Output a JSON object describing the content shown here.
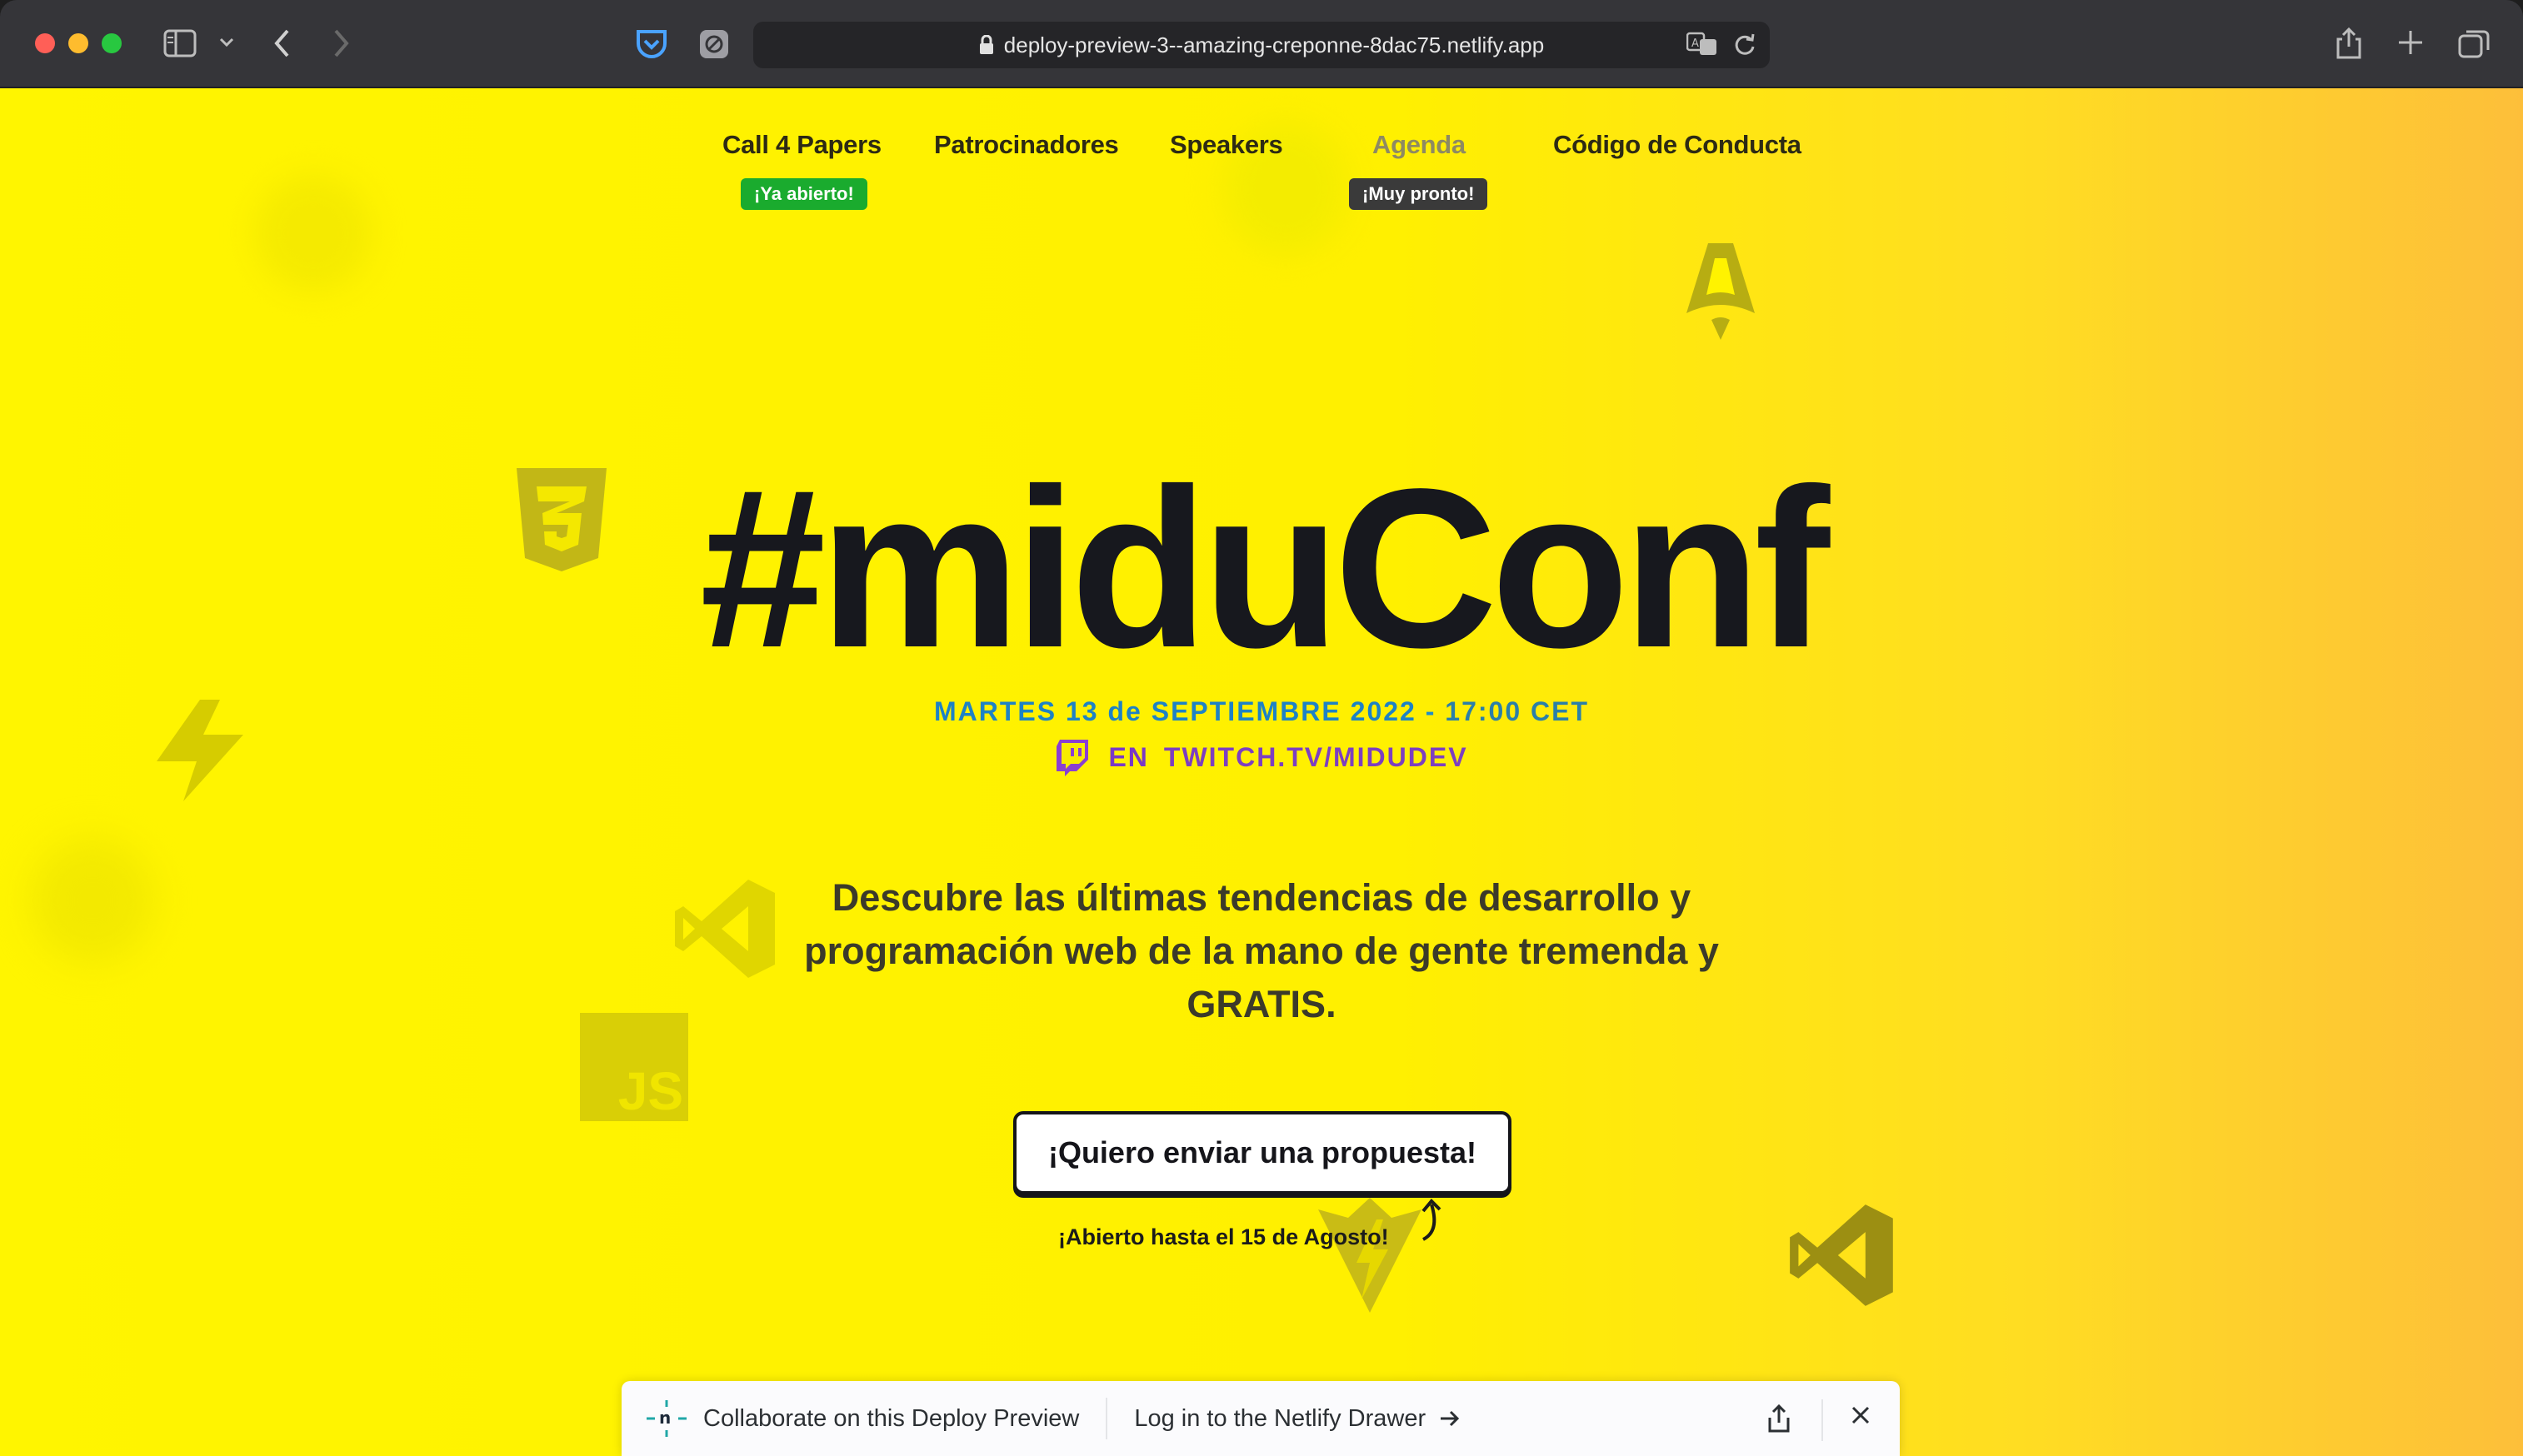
{
  "browser": {
    "url": "deploy-preview-3--amazing-creponne-8dac75.netlify.app"
  },
  "nav": {
    "items": [
      {
        "label": "Call 4 Papers",
        "badge": "¡Ya abierto!"
      },
      {
        "label": "Patrocinadores"
      },
      {
        "label": "Speakers"
      },
      {
        "label": "Agenda",
        "badge": "¡Muy pronto!"
      },
      {
        "label": "Código de Conducta"
      }
    ]
  },
  "hero": {
    "title": "#miduConf",
    "date": "MARTES 13 de SEPTIEMBRE 2022",
    "separator": " - ",
    "time": "17:00 CET",
    "stream_prefix": "EN",
    "stream_link": "TWITCH.TV/MIDUDEV",
    "description": "Descubre las últimas tendencias de desarrollo y programación web de la mano de gente tremenda y GRATIS.",
    "cta_label": "¡Quiero enviar una propuesta!",
    "cta_note": "¡Abierto hasta el 15 de Agosto!"
  },
  "decorations": {
    "js_label": "JS"
  },
  "netlify_drawer": {
    "collaborate": "Collaborate on this Deploy Preview",
    "login": "Log in to the Netlify Drawer"
  },
  "colors": {
    "page_yellow": "#fff500",
    "page_orange": "#fdbf3a",
    "badge_green": "#1aab2e",
    "badge_dark": "#3a3a3a",
    "date_blue": "#1e82c5",
    "twitch_purple": "#7a39c6",
    "title_dark": "#17181e"
  }
}
